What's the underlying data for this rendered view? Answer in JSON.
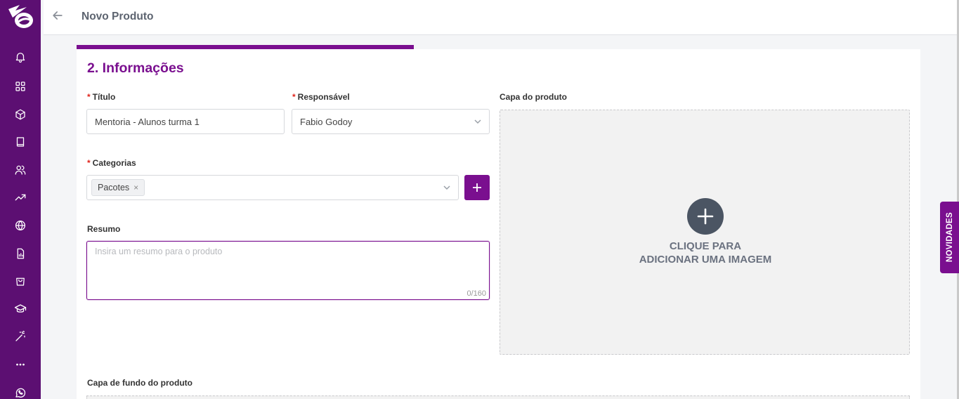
{
  "header": {
    "title": "Novo Produto"
  },
  "section": {
    "title": "2. Informações"
  },
  "form": {
    "required_mark": "*",
    "titulo": {
      "label": "Título",
      "value": "Mentoria - Alunos turma 1"
    },
    "responsavel": {
      "label": "Responsável",
      "value": "Fabio Godoy"
    },
    "categorias": {
      "label": "Categorias",
      "tags": [
        "Pacotes"
      ],
      "remove_glyph": "×"
    },
    "resumo": {
      "label": "Resumo",
      "placeholder": "Insira um resumo para o produto",
      "counter": "0/160"
    },
    "capa": {
      "label": "Capa do produto",
      "cta_line1": "CLIQUE PARA",
      "cta_line2": "ADICIONAR UMA IMAGEM"
    },
    "capa_fundo": {
      "label": "Capa de fundo do produto"
    }
  },
  "news_tab": {
    "label": "NOVIDADES"
  },
  "progress": {
    "fraction": 0.4
  },
  "colors": {
    "brand": "#7a0f8f",
    "sidebar": "#5c0f72",
    "required": "#e0231b"
  },
  "sidebar_icons": [
    "logo-icon",
    "bell-icon",
    "grid-icon",
    "cube-icon",
    "book-icon",
    "users-icon",
    "trending-up-icon",
    "globe-icon",
    "report-icon",
    "shopping-bag-icon",
    "graduation-cap-icon",
    "magic-wand-icon",
    "more-icon",
    "whatsapp-icon"
  ]
}
